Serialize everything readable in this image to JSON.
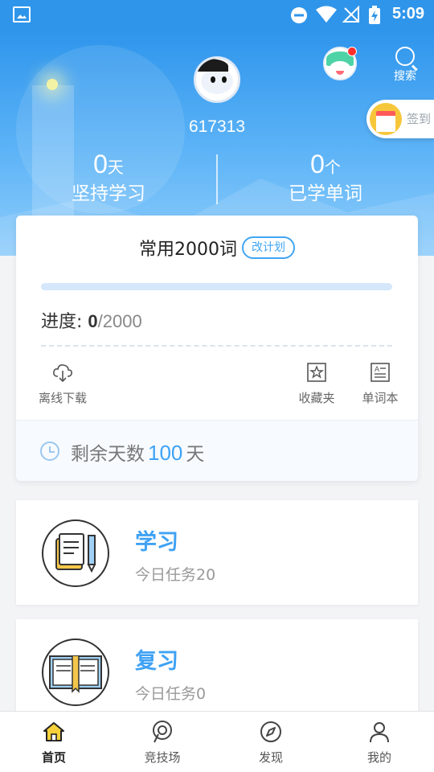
{
  "status_bar": {
    "time": "5:09"
  },
  "header": {
    "user_id": "617313",
    "search_label": "搜索",
    "checkin_label": "签到",
    "stats": [
      {
        "value": "0",
        "unit": "天",
        "label": "坚持学习"
      },
      {
        "value": "0",
        "unit": "个",
        "label": "已学单词"
      }
    ]
  },
  "plan": {
    "name": "常用2000词",
    "change_button": "改计划",
    "progress_label": "进度:",
    "progress_value": "0",
    "progress_total": "/2000",
    "progress_fraction": 0,
    "tools": [
      {
        "label": "离线下载",
        "icon": "cloud-download-icon"
      },
      {
        "label": "收藏夹",
        "icon": "star-bookmark-icon"
      },
      {
        "label": "单词本",
        "icon": "wordbook-icon"
      }
    ],
    "remaining_prefix": "剩余天数",
    "remaining_days": "100",
    "remaining_suffix": "天"
  },
  "tasks": [
    {
      "title": "学习",
      "subtitle": "今日任务20",
      "icon": "notebook-pen-icon"
    },
    {
      "title": "复习",
      "subtitle": "今日任务0",
      "icon": "open-book-icon"
    }
  ],
  "bottom_nav": [
    {
      "label": "首页",
      "icon": "home-icon",
      "active": true
    },
    {
      "label": "竞技场",
      "icon": "arena-icon",
      "active": false
    },
    {
      "label": "发现",
      "icon": "compass-icon",
      "active": false
    },
    {
      "label": "我的",
      "icon": "person-icon",
      "active": false
    }
  ],
  "colors": {
    "accent": "#3fa2f4",
    "header_top": "#2e95ec",
    "home_active": "#f7d13b"
  }
}
